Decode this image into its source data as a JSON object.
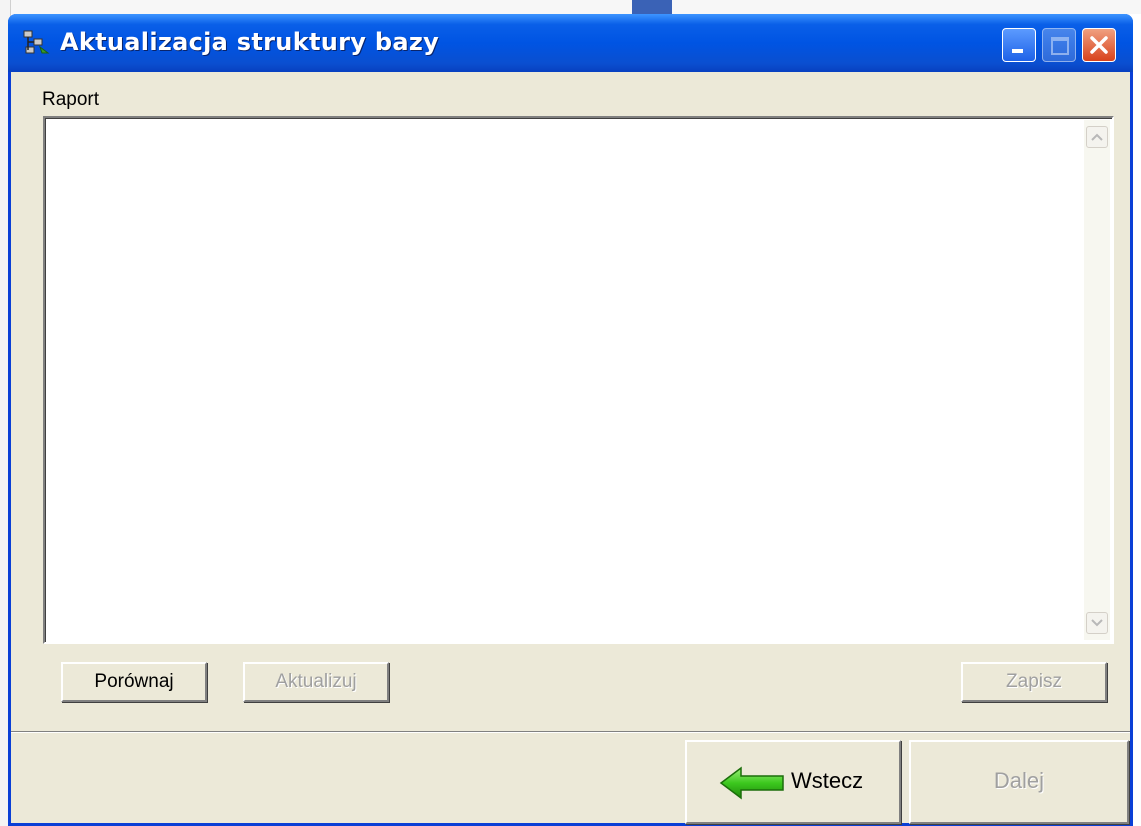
{
  "window": {
    "title": "Aktualizacja struktury bazy",
    "app_icon": "database-tree-icon"
  },
  "titlebar_buttons": {
    "minimize": "minimize-icon",
    "maximize": "maximize-icon",
    "close": "close-icon"
  },
  "report": {
    "label": "Raport",
    "content": ""
  },
  "actions": {
    "compare_label": "Porównaj",
    "update_label": "Aktualizuj",
    "save_label": "Zapisz"
  },
  "navigation": {
    "back_label": "Wstecz",
    "next_label": "Dalej",
    "back_icon": "green-left-arrow-icon"
  },
  "colors": {
    "titlebar": "#0054e3",
    "face": "#ece9d8",
    "arrow": "#3cc81e"
  }
}
